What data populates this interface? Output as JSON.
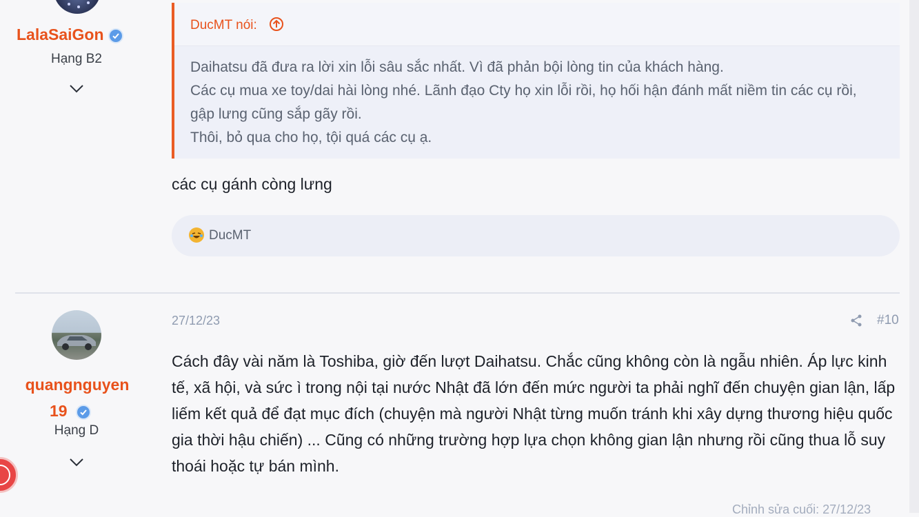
{
  "post1": {
    "username": "LalaSaiGon",
    "rank": "Hạng B2",
    "quote": {
      "author_label": "DucMT nói:",
      "lines": [
        "Daihatsu đã đưa ra lời xin lỗi sâu sắc nhất. Vì đã phản bội lòng tin của khách hàng.",
        "Các cụ mua xe toy/dai hài lòng nhé. Lãnh đạo Cty họ xin lỗi rồi, họ hối hận đánh mất niềm tin các cụ rồi, gập lưng cũng sắp gãy rồi.",
        "Thôi, bỏ qua cho họ, tội quá các cụ ạ."
      ]
    },
    "reply": "các cụ gánh còng lưng",
    "reaction_user": "DucMT"
  },
  "post2": {
    "username": "quangnguyen19",
    "username_line1": "quangnguyen",
    "username_line2": "19",
    "rank": "Hạng D",
    "date": "27/12/23",
    "post_number": "#10",
    "body": "Cách đây vài năm là Toshiba, giờ đến lượt Daihatsu. Chắc cũng không còn là ngẫu nhiên. Áp lực kinh tế, xã hội, và sức ì trong nội tại nước Nhật đã lớn đến mức người ta phải nghĩ đến chuyện gian lận, lấp liếm kết quả để đạt mục đích (chuyện mà người Nhật từng muốn tránh khi xây dựng thương hiệu quốc gia thời hậu chiến) ... Cũng có những trường hợp lựa chọn không gian lận nhưng rồi cũng thua lỗ suy thoái hoặc tự bán mình.",
    "edited_label": "Chỉnh sửa cuối: 27/12/23"
  },
  "icons": {
    "verified": "verified-badge-icon",
    "chevron": "chevron-down-icon",
    "quote_jump": "arrow-up-circle-icon",
    "reaction": "laughing-emoji-icon",
    "share": "share-icon",
    "notification": "notification-bell-icon"
  },
  "colors": {
    "username": "#e8521c",
    "quote_border": "#ea5c24",
    "verified": "#5b9be8",
    "muted": "#8f9bb0"
  }
}
